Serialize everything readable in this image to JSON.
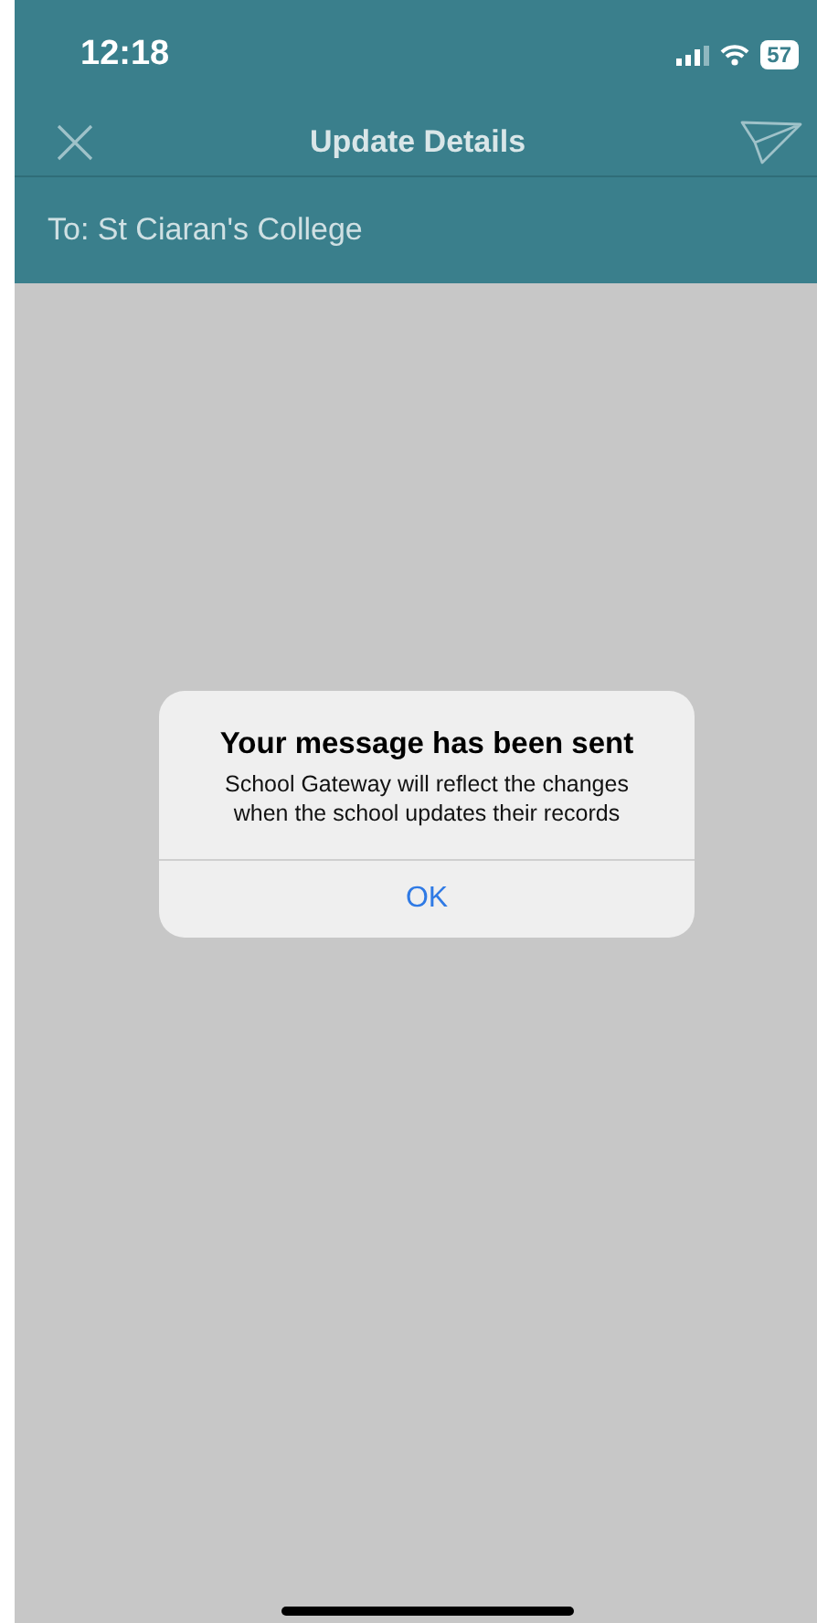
{
  "status_bar": {
    "time": "12:18",
    "battery": "57"
  },
  "nav_bar": {
    "title": "Update Details"
  },
  "recipient": "To: St Ciaran's College",
  "alert": {
    "title": "Your message has been sent",
    "message": "School Gateway will reflect the changes when the school updates their records",
    "buttons": [
      "OK"
    ]
  }
}
